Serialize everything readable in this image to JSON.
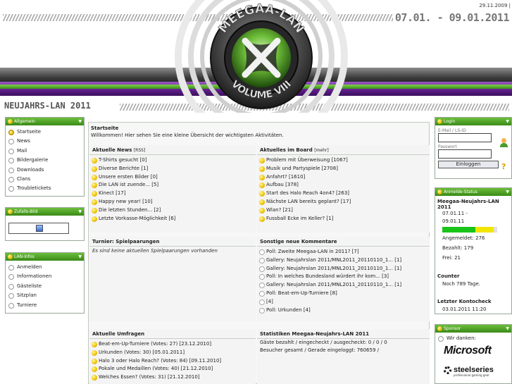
{
  "header": {
    "date": "29.11.2009 |",
    "event_dates": "07.01. - 09.01.2011",
    "subtitle": "NEUJAHRS-LAN 2011",
    "logo_top": "MEEGAA-LAN",
    "logo_bottom": "VOLUME VIII"
  },
  "left": {
    "allgemein": {
      "title": "Allgemein",
      "items": [
        "Startseite",
        "News",
        "Mail",
        "Bildergalerie",
        "Downloads",
        "Clans",
        "Troubletickets"
      ]
    },
    "zufall": {
      "title": "Zufalls-Bild"
    },
    "lan_infos": {
      "title": "LAN-Infos",
      "items": [
        "Anmelden",
        "Informationen",
        "Gästeliste",
        "Sitzplan",
        "Turniere"
      ]
    }
  },
  "main": {
    "title": "Startseite",
    "welcome": "Willkommen! Hier sehen Sie eine kleine Übersicht der wichtigsten Aktivitäten.",
    "news": {
      "title": "Aktuelle News",
      "rss": "[RSS]",
      "items": [
        "T-Shirts gesucht [0]",
        "Diverse Berichte [1]",
        "Unsere ersten Bilder [0]",
        "Die LAN ist zuende... [5]",
        "Kinect [17]",
        "Happy new year! [10]",
        "Die letzten Stunden... [2]",
        "Letzte Vorkasse-Möglichkeit [6]"
      ]
    },
    "board": {
      "title": "Aktuelles im Board",
      "more": "[mehr]",
      "items": [
        "Problem mit Überweisung [1067]",
        "Musik und Partyspiele [2708]",
        "Anfahrt? [1610]",
        "Aufbau [378]",
        "Start des Halo Reach 4on4? [263]",
        "Nächste LAN bereits geplant? [17]",
        "Wlan? [21]",
        "Fussball Ecke im Keller? [1]"
      ]
    },
    "turnier": {
      "title": "Turnier: Spielpaarungen",
      "empty": "Es sind keine aktuellen Spielpaarungen vorhanden"
    },
    "kommentare": {
      "title": "Sonstige neue Kommentare",
      "items": [
        "Poll: Zweite Meegaa-LAN in 2011? [7]",
        "Gallery: Neujahrslan 2011/MNL2011_20110110_1... [1]",
        "Gallery: Neujahrslan 2011/MNL2011_20110110_1... [1]",
        "Poll: In welches Bundesland würdert ihr kom... [3]",
        "Gallery: Neujahrslan 2011/MNL2011_20110110_1... [1]",
        "Poll: Beat-em-Up-Turniere [8]",
        "[4]",
        "Poll: Urkunden [4]"
      ]
    },
    "umfragen": {
      "title": "Aktuelle Umfragen",
      "items": [
        "Beat-em-Up-Turniere (Votes: 27) [23.12.2010]",
        "Urkunden (Votes: 30) [05.01.2011]",
        "Halo 3 oder Halo Reach? (Votes: 84) [09.11.2010]",
        "Pokale und Medaillen (Votes: 40) [21.12.2010]",
        "Welches Essen? (Votes: 31) [21.12.2010]"
      ]
    },
    "statistik": {
      "title": "Statistiken Meegaa-Neujahrs-LAN 2011",
      "line1": "Gäste bezahlt / eingecheckt / ausgecheckt: 0 / 0 / 0",
      "line2": "Besucher gesamt / Gerade eingeloggt: 760659 /"
    }
  },
  "right": {
    "login": {
      "title": "Login",
      "email_label": "E-Mail / LS-ID",
      "password_label": "Passwort",
      "button": "Einloggen"
    },
    "status": {
      "title": "Anmelde-Status",
      "event": "Meegaa-Neujahrs-LAN 2011",
      "dates_line1": "07.01.11 -",
      "dates_line2": "09.01.11",
      "angemeldet": "Angemeldet: 276",
      "bezahlt": "Bezahlt: 179",
      "frei": "Frei: 21",
      "paid_fraction": 0.605,
      "signed_fraction": 0.931
    },
    "counter": {
      "title": "Counter",
      "value": "Noch 789 Tage."
    },
    "kontocheck": {
      "title": "Letzter Kontocheck",
      "value": "03.01.2011 11:20"
    },
    "sponsor": {
      "title": "Sponsor",
      "thanks": "Wir danken:",
      "sponsor1": "Microsoft",
      "sponsor2": "steelseries",
      "sponsor2_tag": "professional gaming gear"
    }
  }
}
